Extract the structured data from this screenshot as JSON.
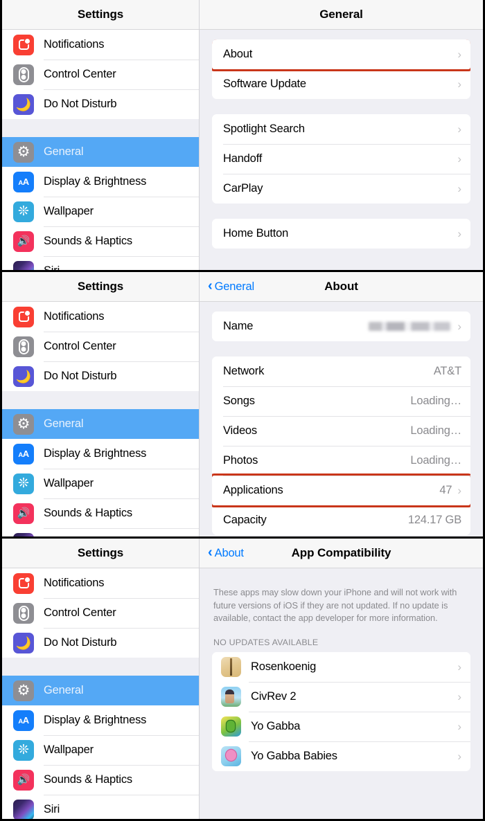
{
  "sidebar": {
    "title": "Settings",
    "items": [
      {
        "label": "Notifications",
        "icon": "notifications-icon",
        "selected": false
      },
      {
        "label": "Control Center",
        "icon": "control-center-icon",
        "selected": false
      },
      {
        "label": "Do Not Disturb",
        "icon": "do-not-disturb-icon",
        "selected": false
      },
      {
        "label": "General",
        "icon": "general-gear-icon",
        "selected": true
      },
      {
        "label": "Display & Brightness",
        "icon": "display-brightness-icon",
        "selected": false
      },
      {
        "label": "Wallpaper",
        "icon": "wallpaper-icon",
        "selected": false
      },
      {
        "label": "Sounds & Haptics",
        "icon": "sounds-haptics-icon",
        "selected": false
      },
      {
        "label": "Siri",
        "icon": "siri-icon",
        "selected": false
      }
    ]
  },
  "panel_general": {
    "nav_title": "General",
    "group1": [
      {
        "label": "About",
        "value": "",
        "chevron": "›",
        "highlighted": true
      },
      {
        "label": "Software Update",
        "value": "",
        "chevron": "›",
        "highlighted": false
      }
    ],
    "group2": [
      {
        "label": "Spotlight Search",
        "value": "",
        "chevron": "›"
      },
      {
        "label": "Handoff",
        "value": "",
        "chevron": "›"
      },
      {
        "label": "CarPlay",
        "value": "",
        "chevron": "›"
      }
    ],
    "group3": [
      {
        "label": "Home Button",
        "value": "",
        "chevron": "›"
      }
    ]
  },
  "panel_about": {
    "nav_title": "About",
    "back_label": "General",
    "back_chevron": "‹",
    "group_name": [
      {
        "label": "Name",
        "value": "",
        "redacted": true,
        "chevron": "›"
      }
    ],
    "group_info": [
      {
        "label": "Network",
        "value": "AT&T",
        "chevron": "",
        "highlighted": false
      },
      {
        "label": "Songs",
        "value": "Loading…",
        "chevron": "",
        "highlighted": false
      },
      {
        "label": "Videos",
        "value": "Loading…",
        "chevron": "",
        "highlighted": false
      },
      {
        "label": "Photos",
        "value": "Loading…",
        "chevron": "",
        "highlighted": false
      },
      {
        "label": "Applications",
        "value": "47",
        "chevron": "›",
        "highlighted": true
      },
      {
        "label": "Capacity",
        "value": "124.17 GB",
        "chevron": "",
        "highlighted": false
      }
    ]
  },
  "panel_compat": {
    "nav_title": "App Compatibility",
    "back_label": "About",
    "back_chevron": "‹",
    "note": "These apps may slow down your iPhone and will not work with future versions of iOS if they are not updated. If no update is available, contact the app developer for more information.",
    "section_label": "NO UPDATES AVAILABLE",
    "apps": [
      {
        "name": "Rosenkoenig",
        "icon": "app-icon-rosenkoenig",
        "chevron": "›"
      },
      {
        "name": "CivRev 2",
        "icon": "app-icon-civrev2",
        "chevron": "›"
      },
      {
        "name": "Yo Gabba",
        "icon": "app-icon-yo-gabba",
        "chevron": "›"
      },
      {
        "name": "Yo Gabba Babies",
        "icon": "app-icon-yo-gabba-babies",
        "chevron": "›"
      }
    ]
  },
  "colors": {
    "accent_blue": "#007aff",
    "selection_blue": "#54a8f5",
    "highlight_red": "#c9361a",
    "group_background": "#efeff4",
    "secondary_text": "#8a8a8e"
  }
}
